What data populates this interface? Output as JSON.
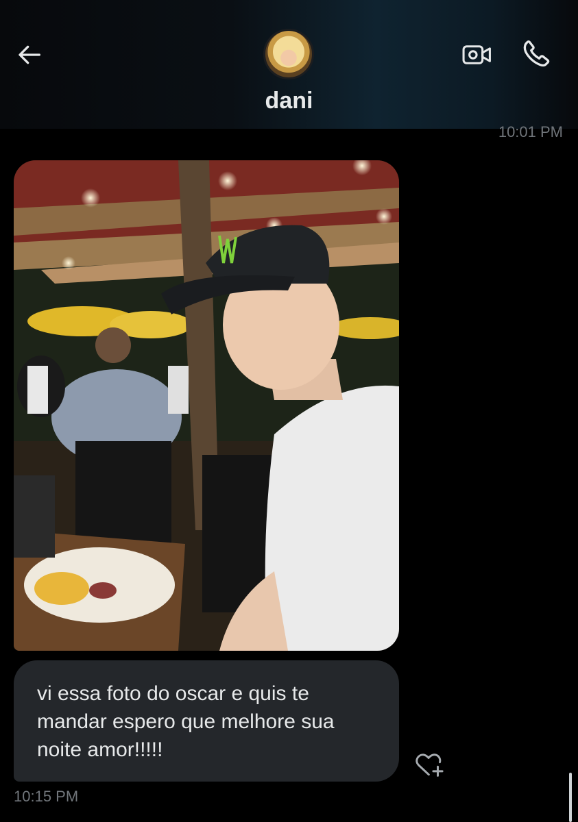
{
  "header": {
    "contact_name": "dani",
    "icons": {
      "back": "arrow-left-icon",
      "video": "video-camera-icon",
      "phone": "phone-icon"
    }
  },
  "messages": [
    {
      "type": "timestamp",
      "text": "10:01 PM"
    },
    {
      "type": "image",
      "sender": "dani",
      "description_hidden": true
    },
    {
      "type": "text",
      "sender": "dani",
      "text": "vi essa foto do oscar e quis te mandar espero que melhore sua noite amor!!!!!"
    },
    {
      "type": "timestamp",
      "text": "10:15 PM"
    }
  ],
  "reaction": {
    "icon": "heart-plus-icon"
  },
  "colors": {
    "background": "#000000",
    "bubble": "#24272b",
    "text": "#e7e9ea",
    "muted": "#71767b"
  }
}
